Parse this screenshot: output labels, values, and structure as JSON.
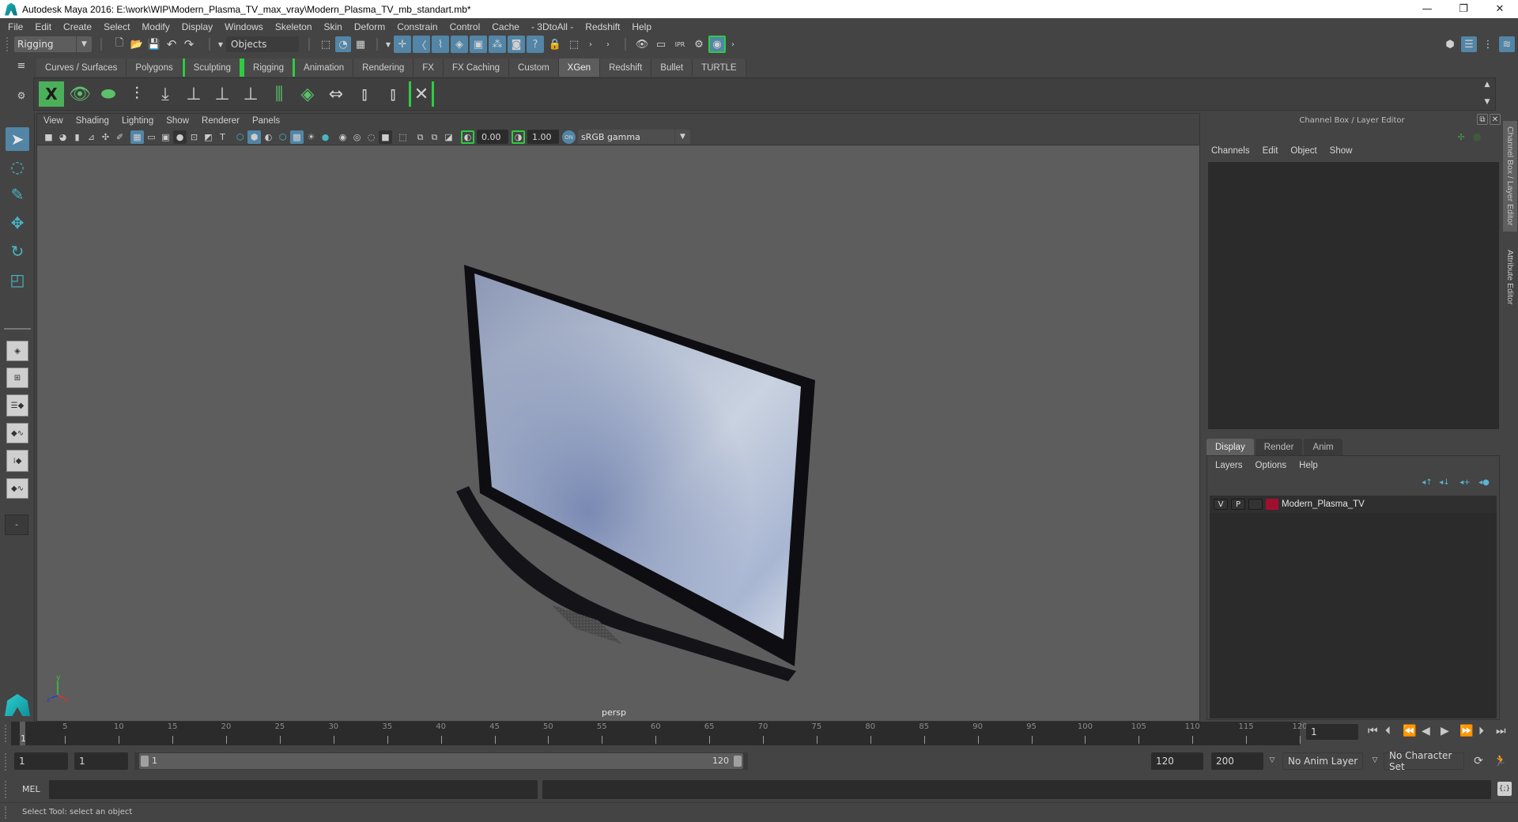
{
  "window": {
    "title": "Autodesk Maya 2016: E:\\work\\WIP\\Modern_Plasma_TV_max_vray\\Modern_Plasma_TV_mb_standart.mb*",
    "controls": {
      "minimize": "—",
      "restore": "❐",
      "close": "✕"
    }
  },
  "menubar": {
    "items": [
      "File",
      "Edit",
      "Create",
      "Select",
      "Modify",
      "Display",
      "Windows",
      "Skeleton",
      "Skin",
      "Deform",
      "Constrain",
      "Control",
      "Cache",
      "- 3DtoAll -",
      "Redshift",
      "Help"
    ]
  },
  "statusline": {
    "menuset": "Rigging",
    "selection_mode": "Objects",
    "file_icons": [
      "new-scene-icon",
      "open-scene-icon",
      "save-scene-icon",
      "undo-icon",
      "redo-icon"
    ],
    "select_mode_icons": [
      "select-by-hierarchy-icon",
      "select-by-object-type-icon",
      "select-by-component-type-icon"
    ],
    "snap_icons": [
      "snap-grid-icon",
      "snap-curve-icon",
      "snap-point-icon",
      "snap-view-plane-icon",
      "snap-live-icon",
      "snap-components-icon",
      "make-live-icon",
      "snap-help-icon"
    ],
    "render_icons": [
      "render-view-icon",
      "render-current-frame-icon",
      "ipr-render-icon",
      "render-settings-icon",
      "hypershade-icon"
    ]
  },
  "shelf": {
    "tabs": [
      {
        "label": "Curves / Surfaces",
        "active": false
      },
      {
        "label": "Polygons",
        "active": false
      },
      {
        "label": "Sculpting",
        "active": false
      },
      {
        "label": "Rigging",
        "active": false
      },
      {
        "label": "Animation",
        "active": false
      },
      {
        "label": "Rendering",
        "active": false
      },
      {
        "label": "FX",
        "active": false
      },
      {
        "label": "FX Caching",
        "active": false
      },
      {
        "label": "Custom",
        "active": false
      },
      {
        "label": "XGen",
        "active": true
      },
      {
        "label": "Redshift",
        "active": false
      },
      {
        "label": "Bullet",
        "active": false
      },
      {
        "label": "TURTLE",
        "active": false
      }
    ],
    "icons": [
      "xgen-window-icon",
      "preview-visible-icon",
      "preview-hide-icon",
      "create-description-icon",
      "import-collection-icon",
      "add-guide-icon",
      "guide-visibility-icon",
      "lock-guides-icon",
      "guide-split-icon",
      "grid-patch-icon",
      "guide-sync-icon",
      "select-guides-icon",
      "clear-guides-icon",
      "xgen-delete-icon"
    ]
  },
  "toolbox": {
    "tools": [
      "select-tool-icon",
      "lasso-tool-icon",
      "paint-select-tool-icon",
      "move-tool-icon",
      "rotate-tool-icon",
      "scale-tool-icon"
    ],
    "layouts": [
      "single-perspective-layout",
      "four-view-layout",
      "persp-outliner-layout",
      "persp-graph-layout",
      "hypershade-persp-layout",
      "persp-graph-hypershade-layout"
    ],
    "more_label": "-"
  },
  "viewport": {
    "menus": [
      "View",
      "Shading",
      "Lighting",
      "Show",
      "Renderer",
      "Panels"
    ],
    "exposure": "0.00",
    "gamma": "1.00",
    "color_space": "sRGB gamma",
    "camera_label": "persp",
    "axis_labels": {
      "x": "x",
      "y": "y",
      "z": "z"
    }
  },
  "channel_box": {
    "title": "Channel Box / Layer Editor",
    "menus": [
      "Channels",
      "Edit",
      "Object",
      "Show"
    ]
  },
  "layer_editor": {
    "tabs": [
      {
        "label": "Display",
        "active": true
      },
      {
        "label": "Render",
        "active": false
      },
      {
        "label": "Anim",
        "active": false
      }
    ],
    "menus": [
      "Layers",
      "Options",
      "Help"
    ],
    "layers": [
      {
        "visible": "V",
        "playback": "P",
        "type": "",
        "color": "#a0102e",
        "name": "Modern_Plasma_TV"
      }
    ]
  },
  "side_tabs": [
    "Channel Box / Layer Editor",
    "Attribute Editor"
  ],
  "timeline": {
    "ticks": [
      5,
      10,
      15,
      20,
      25,
      30,
      35,
      40,
      45,
      50,
      55,
      60,
      65,
      70,
      75,
      80,
      85,
      90,
      95,
      100,
      105,
      110,
      115,
      120
    ],
    "start": 1,
    "end": 120,
    "current_frame_label": "1",
    "current_frame": "1"
  },
  "range": {
    "start_time": "1",
    "playback_start": "1",
    "slider_start": "1",
    "slider_end": "120",
    "playback_end": "120",
    "end_time": "200",
    "anim_layer": "No Anim Layer",
    "character_set": "No Character Set"
  },
  "playback": {
    "buttons": [
      "go-to-start-icon",
      "step-back-frame-icon",
      "step-back-key-icon",
      "play-backwards-icon",
      "play-forwards-icon",
      "step-forward-key-icon",
      "step-forward-frame-icon",
      "go-to-end-icon"
    ]
  },
  "command_line": {
    "label": "MEL",
    "value": "",
    "result": ""
  },
  "help_line": {
    "text": "Select Tool: select an object"
  },
  "colors": {
    "accent_blue": "#5285a6",
    "shelf_green": "#2ecc40",
    "maya_teal": "#1fb7b7",
    "layer_color": "#a0102e",
    "playback_key_orange": "#e07b39"
  }
}
